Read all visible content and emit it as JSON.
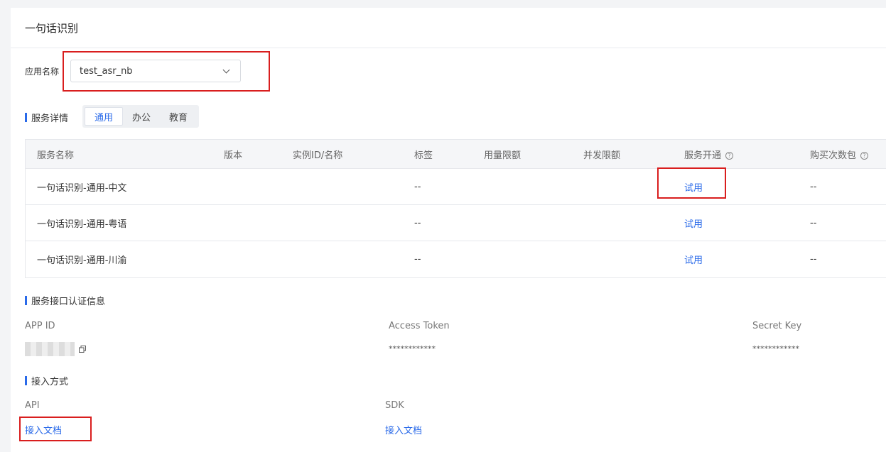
{
  "page": {
    "title": "一句话识别"
  },
  "app_select": {
    "label": "应用名称",
    "value": "test_asr_nb"
  },
  "service_details": {
    "title": "服务详情",
    "tabs": [
      "通用",
      "办公",
      "教育"
    ],
    "active_tab": 0,
    "columns": [
      "服务名称",
      "版本",
      "实例ID/名称",
      "标签",
      "用量限额",
      "并发限额",
      "服务开通",
      "购买次数包"
    ],
    "rows": [
      {
        "name": "一句话识别-通用-中文",
        "tag": "--",
        "action": "试用",
        "purchase": "--"
      },
      {
        "name": "一句话识别-通用-粤语",
        "tag": "--",
        "action": "试用",
        "purchase": "--"
      },
      {
        "name": "一句话识别-通用-川渝",
        "tag": "--",
        "action": "试用",
        "purchase": "--"
      }
    ]
  },
  "credentials": {
    "title": "服务接口认证信息",
    "app_id_label": "APP ID",
    "access_token_label": "Access Token",
    "access_token_value": "************",
    "secret_key_label": "Secret Key",
    "secret_key_value": "************"
  },
  "access": {
    "title": "接入方式",
    "api_label": "API",
    "api_link": "接入文档",
    "sdk_label": "SDK",
    "sdk_link": "接入文档"
  },
  "colors": {
    "accent": "#2a6ae9",
    "highlight_box": "#d91e1e"
  },
  "icons": [
    "chevron-down-icon",
    "help-icon",
    "copy-icon"
  ]
}
